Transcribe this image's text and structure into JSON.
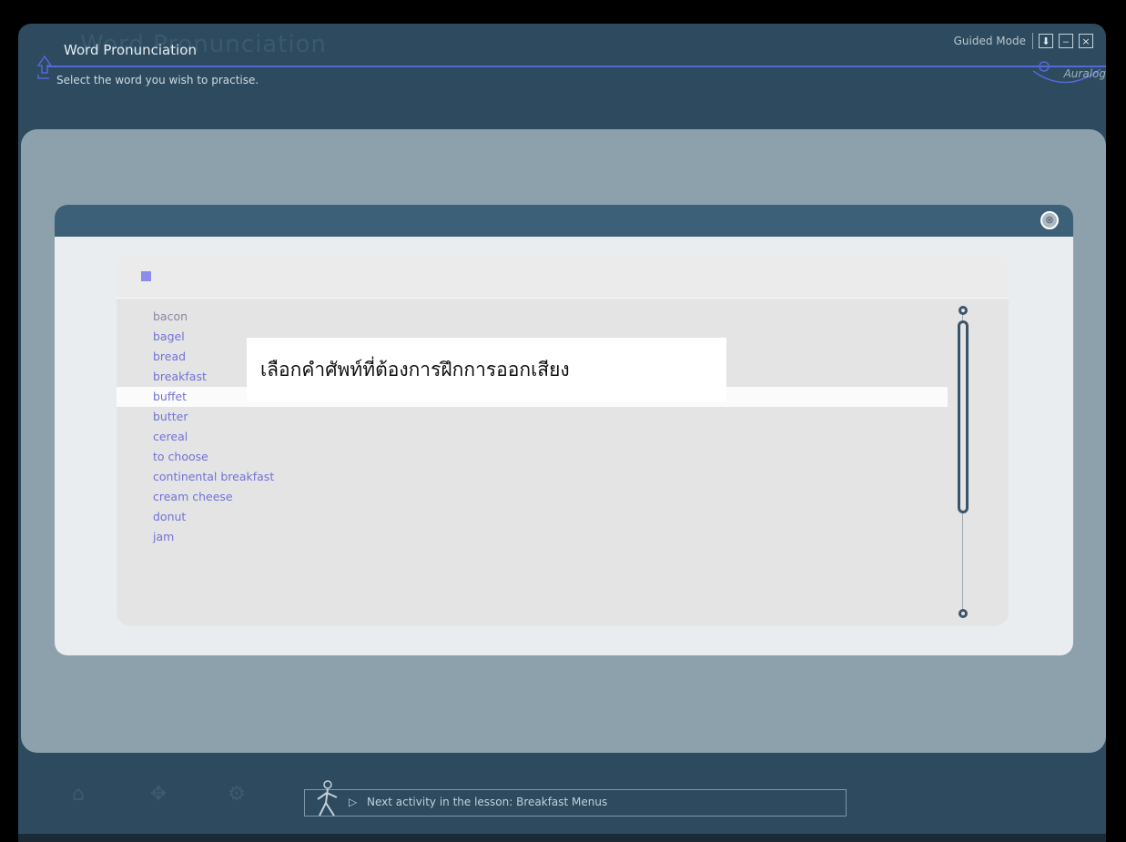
{
  "header": {
    "title": "Word Pronunciation",
    "ghost_title": "Word Pronunciation",
    "subtitle": "Select the word you wish to practise.",
    "mode_label": "Guided Mode",
    "logo_text": "Auralog",
    "window_buttons": {
      "download": "⬇",
      "minimize": "‒",
      "close": "×"
    }
  },
  "dialog": {
    "close_icon": "⊗",
    "words": [
      "bacon",
      "bagel",
      "bread",
      "breakfast",
      "buffet",
      "butter",
      "cereal",
      "to choose",
      "continental breakfast",
      "cream cheese",
      "donut",
      "jam"
    ],
    "selected_index": 4
  },
  "tooltip": {
    "text": "เลือกคำศัพท์ที่ต้องการฝึกการออกเสียง"
  },
  "footer": {
    "next_activity": "Next activity in the lesson: Breakfast Menus",
    "play_icon": "▷"
  },
  "colors": {
    "app_background": "#2d4a5e",
    "content_background": "#8ca1ab",
    "dialog_bar": "#3b6078",
    "word_link": "#7272d6",
    "accent_line": "#5668d8"
  }
}
